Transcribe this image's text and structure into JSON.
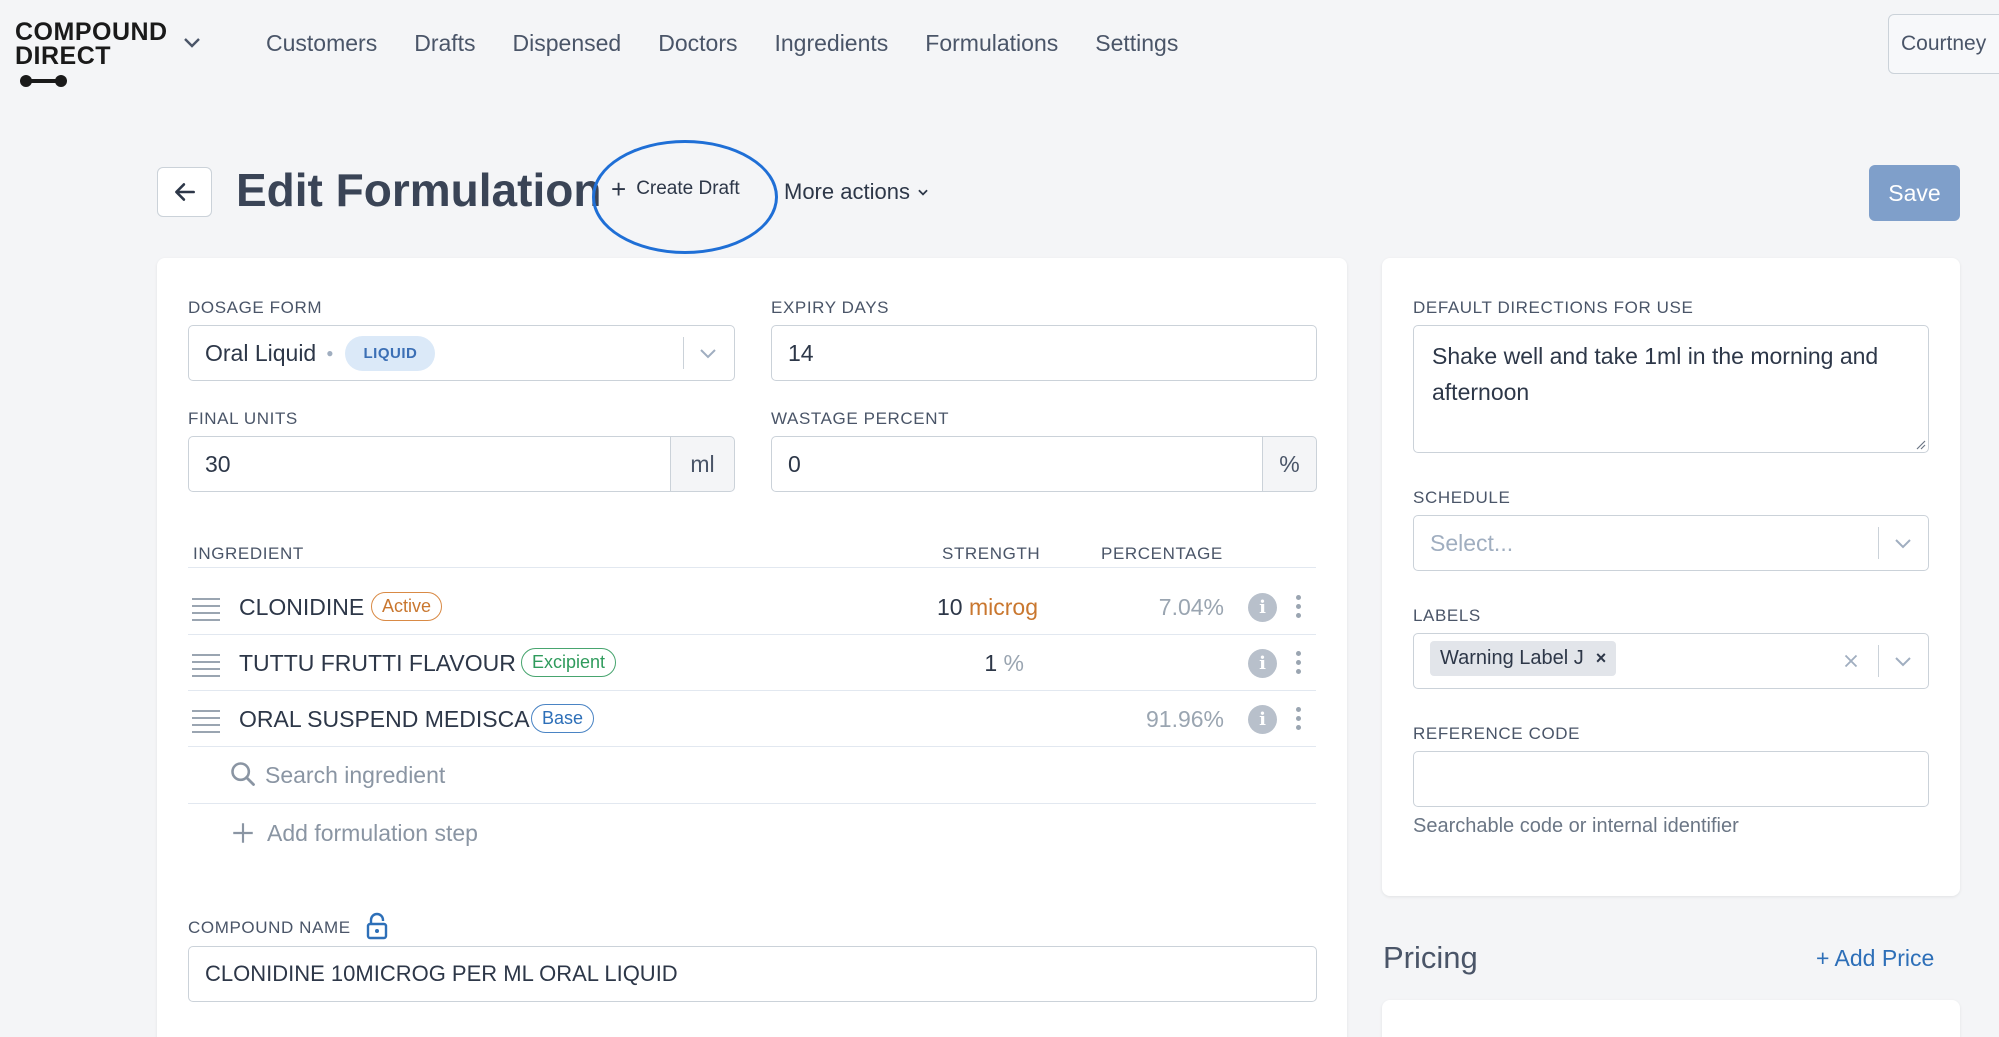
{
  "brand": {
    "line1": "COMPOUND",
    "line2": "DIRECT"
  },
  "nav": {
    "items": [
      {
        "label": "Customers"
      },
      {
        "label": "Drafts"
      },
      {
        "label": "Dispensed"
      },
      {
        "label": "Doctors"
      },
      {
        "label": "Ingredients"
      },
      {
        "label": "Formulations"
      },
      {
        "label": "Settings"
      }
    ],
    "user": "Courtney"
  },
  "header": {
    "title": "Edit Formulation",
    "create_draft": "Create Draft",
    "more_actions": "More actions",
    "save": "Save"
  },
  "form": {
    "dosage_form_label": "DOSAGE FORM",
    "dosage_form_value": "Oral Liquid",
    "dosage_form_badge": "LIQUID",
    "expiry_days_label": "EXPIRY DAYS",
    "expiry_days_value": "14",
    "final_units_label": "FINAL UNITS",
    "final_units_value": "30",
    "final_units_unit": "ml",
    "wastage_label": "WASTAGE PERCENT",
    "wastage_value": "0",
    "wastage_unit": "%"
  },
  "ingredients": {
    "col_ingredient": "INGREDIENT",
    "col_strength": "STRENGTH",
    "col_percentage": "PERCENTAGE",
    "rows": [
      {
        "name": "CLONIDINE",
        "tag": "Active",
        "strength": "10",
        "unit": "microg",
        "percentage": "7.04%"
      },
      {
        "name": "TUTTU FRUTTI FLAVOUR",
        "tag": "Excipient",
        "strength": "1",
        "unit": "%",
        "percentage": ""
      },
      {
        "name": "ORAL SUSPEND MEDISCA",
        "tag": "Base",
        "strength": "",
        "unit": "",
        "percentage": "91.96%"
      }
    ],
    "search_placeholder": "Search ingredient",
    "add_step": "Add formulation step"
  },
  "compound": {
    "label": "COMPOUND NAME",
    "value": "CLONIDINE 10MICROG PER ML ORAL LIQUID"
  },
  "side": {
    "directions_label": "DEFAULT DIRECTIONS FOR USE",
    "directions_value": "Shake well and take 1ml in the morning and afternoon",
    "schedule_label": "SCHEDULE",
    "schedule_placeholder": "Select...",
    "labels_label": "LABELS",
    "labels_chip": "Warning Label J",
    "reference_label": "REFERENCE CODE",
    "reference_value": "",
    "reference_help": "Searchable code or internal identifier"
  },
  "pricing": {
    "title": "Pricing",
    "add_price": "+ Add Price"
  },
  "colors": {
    "primary": "#2d6fb8",
    "save": "#7f9fca",
    "active": "#c9772f",
    "excipient": "#2f9b5c",
    "ring": "#1f6fd6"
  }
}
